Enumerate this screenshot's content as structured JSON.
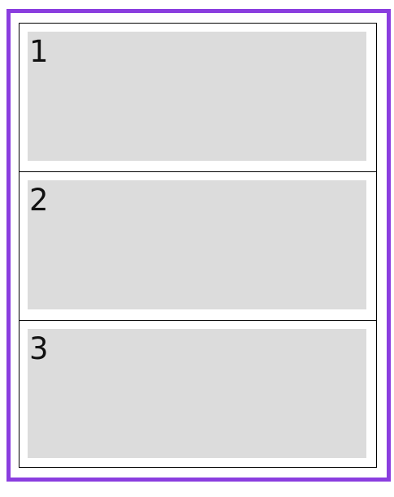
{
  "colors": {
    "outer_border": "#8a3ddf",
    "inner_border": "#000000",
    "card_fill": "#dcdcdc"
  },
  "panels": [
    {
      "label": "1"
    },
    {
      "label": "2"
    },
    {
      "label": "3"
    }
  ]
}
